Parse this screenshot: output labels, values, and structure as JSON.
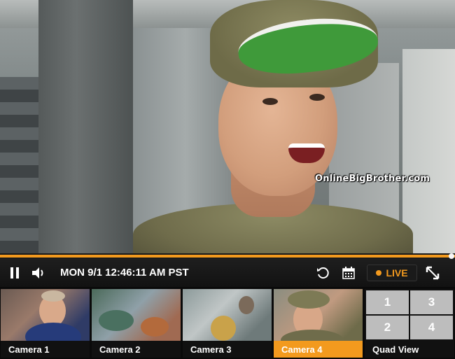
{
  "watermark": "OnlineBigBrother.com",
  "player": {
    "timestamp": "MON 9/1 12:46:11 AM PST",
    "live_label": "LIVE",
    "progress": 1.0,
    "accent_color": "#f39a1e"
  },
  "icons": {
    "pause": "pause-icon",
    "volume": "volume-icon",
    "rewind": "rewind-icon",
    "calendar": "calendar-icon",
    "fullscreen": "fullscreen-icon"
  },
  "cameras": [
    {
      "label": "Camera 1",
      "active": false
    },
    {
      "label": "Camera 2",
      "active": false
    },
    {
      "label": "Camera 3",
      "active": false
    },
    {
      "label": "Camera 4",
      "active": true
    }
  ],
  "quad_view": {
    "label": "Quad View",
    "cells": [
      "1",
      "3",
      "2",
      "4"
    ]
  }
}
